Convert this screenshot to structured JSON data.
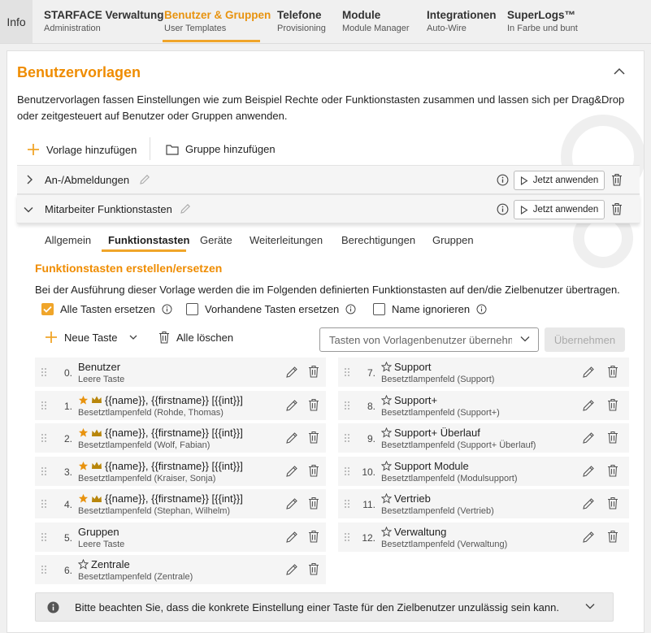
{
  "nav": {
    "info": "Info",
    "items": [
      {
        "title": "STARFACE Verwaltung",
        "subtitle": "Administration"
      },
      {
        "title": "Benutzer & Gruppen",
        "subtitle": "User Templates"
      },
      {
        "title": "Telefone",
        "subtitle": "Provisioning"
      },
      {
        "title": "Module",
        "subtitle": "Module Manager"
      },
      {
        "title": "Integrationen",
        "subtitle": "Auto-Wire"
      },
      {
        "title": "SuperLogs™",
        "subtitle": "In Farbe und bunt"
      }
    ],
    "active_index": 1
  },
  "page": {
    "title": "Benutzervorlagen",
    "description": "Benutzervorlagen fassen Einstellungen wie zum Beispiel Rechte oder Funktionstasten zusammen und lassen sich per Drag&Drop oder zeitgesteuert auf Benutzer oder Gruppen anwenden.",
    "add_template": "Vorlage hinzufügen",
    "add_group": "Gruppe hinzufügen"
  },
  "templates": [
    {
      "name": "An-/Abmeldungen",
      "apply_label": "Jetzt anwenden",
      "expanded": false
    },
    {
      "name": "Mitarbeiter Funktionstasten",
      "apply_label": "Jetzt anwenden",
      "expanded": true
    }
  ],
  "tabs": [
    "Allgemein",
    "Funktionstasten",
    "Geräte",
    "Weiterleitungen",
    "Berechtigungen",
    "Gruppen"
  ],
  "active_tab": "Funktionstasten",
  "section": {
    "title": "Funktionstasten erstellen/ersetzen",
    "description": "Bei der Ausführung dieser Vorlage werden die im Folgenden definierten Funktionstasten auf den/die Zielbenutzer übertragen."
  },
  "options": [
    {
      "label": "Alle Tasten ersetzen",
      "checked": true
    },
    {
      "label": "Vorhandene Tasten ersetzen",
      "checked": false
    },
    {
      "label": "Name ignorieren",
      "checked": false
    }
  ],
  "toolbar": {
    "new_key": "Neue Taste",
    "delete_all": "Alle löschen",
    "source_select": "Tasten von Vorlagenbenutzer übernehmen",
    "apply": "Übernehmen"
  },
  "keys_left": [
    {
      "index": "0.",
      "title": "Benutzer",
      "subtitle": "Leere Taste",
      "icon": "none"
    },
    {
      "index": "1.",
      "title": "{{name}}, {{firstname}} [{{int}}]",
      "subtitle": "Besetztlampenfeld (Rohde, Thomas)",
      "icon": "star-crown"
    },
    {
      "index": "2.",
      "title": "{{name}}, {{firstname}} [{{int}}]",
      "subtitle": "Besetztlampenfeld (Wolf, Fabian)",
      "icon": "star-crown"
    },
    {
      "index": "3.",
      "title": "{{name}}, {{firstname}} [{{int}}]",
      "subtitle": "Besetztlampenfeld (Kraiser, Sonja)",
      "icon": "star-crown"
    },
    {
      "index": "4.",
      "title": "{{name}}, {{firstname}} [{{int}}]",
      "subtitle": "Besetztlampenfeld (Stephan, Wilhelm)",
      "icon": "star-crown"
    },
    {
      "index": "5.",
      "title": "Gruppen",
      "subtitle": "Leere Taste",
      "icon": "none"
    },
    {
      "index": "6.",
      "title": "Zentrale",
      "subtitle": "Besetztlampenfeld (Zentrale)",
      "icon": "star-outline"
    }
  ],
  "keys_right": [
    {
      "index": "7.",
      "title": "Support",
      "subtitle": "Besetztlampenfeld (Support)",
      "icon": "star-outline"
    },
    {
      "index": "8.",
      "title": "Support+",
      "subtitle": "Besetztlampenfeld (Support+)",
      "icon": "star-outline"
    },
    {
      "index": "9.",
      "title": "Support+ Überlauf",
      "subtitle": "Besetztlampenfeld (Support+ Überlauf)",
      "icon": "star-outline"
    },
    {
      "index": "10.",
      "title": "Support Module",
      "subtitle": "Besetztlampenfeld (Modulsupport)",
      "icon": "star-outline"
    },
    {
      "index": "11.",
      "title": "Vertrieb",
      "subtitle": "Besetztlampenfeld (Vertrieb)",
      "icon": "star-outline"
    },
    {
      "index": "12.",
      "title": "Verwaltung",
      "subtitle": "Besetztlampenfeld (Verwaltung)",
      "icon": "star-outline"
    }
  ],
  "notice": "Bitte beachten Sie, dass die konkrete Einstellung einer Taste für den Zielbenutzer unzulässig sein kann.",
  "colors": {
    "accent": "#f0a52a",
    "title": "#ef8c00"
  }
}
